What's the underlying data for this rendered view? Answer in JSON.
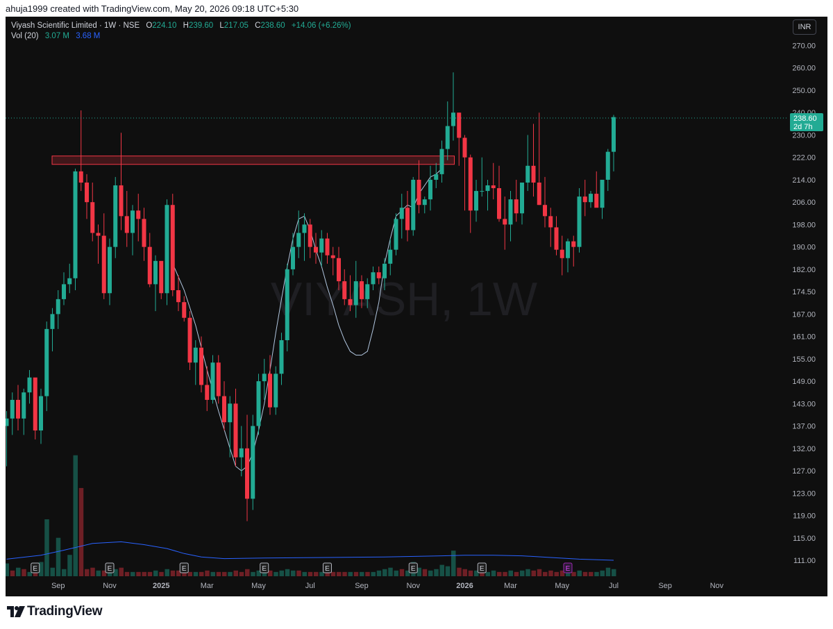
{
  "header": {
    "watermark_text": "ahuja1999 created with TradingView.com, May 20, 2026 09:18 UTC+5:30"
  },
  "legend": {
    "symbol": "Viyash Scientific Limited · 1W · NSE",
    "o_label": "O",
    "o": "224.10",
    "h_label": "H",
    "h": "239.60",
    "l_label": "L",
    "l": "217.05",
    "c_label": "C",
    "c": "238.60",
    "change": "+14.06 (+6.26%)",
    "vol_label": "Vol (20)",
    "vol": "3.07 M",
    "vol_ma": "3.68 M"
  },
  "currency_button": "INR",
  "background_watermark": "VIYASH, 1W",
  "last_price": {
    "value": "238.60",
    "countdown": "2d 7h"
  },
  "earnings_marker": "E",
  "footer": {
    "brand": "TradingView"
  },
  "colors": {
    "up": "#22ab94",
    "down": "#f23645",
    "ma": "#b2c7e0",
    "vol_ma": "#2962ff",
    "zone": "#f23645"
  },
  "chart_data": {
    "type": "candlestick",
    "symbol": "Viyash Scientific Limited",
    "interval": "1W",
    "exchange": "NSE",
    "currency": "INR",
    "y_ticks": [
      270.0,
      260.0,
      250.0,
      240.0,
      230.0,
      222.0,
      214.0,
      206.0,
      198.0,
      190.0,
      182.0,
      174.5,
      167.0,
      161.0,
      155.0,
      149.0,
      143.0,
      137.0,
      132.0,
      127.0,
      123.0,
      119.0,
      115.0,
      111.0
    ],
    "x_ticks": [
      {
        "label": "Sep",
        "bar": 9
      },
      {
        "label": "Nov",
        "bar": 18
      },
      {
        "label": "2025",
        "bar": 27
      },
      {
        "label": "Mar",
        "bar": 35
      },
      {
        "label": "May",
        "bar": 44
      },
      {
        "label": "Jul",
        "bar": 53
      },
      {
        "label": "Sep",
        "bar": 62
      },
      {
        "label": "Nov",
        "bar": 71
      },
      {
        "label": "2026",
        "bar": 80
      },
      {
        "label": "Mar",
        "bar": 88
      },
      {
        "label": "May",
        "bar": 97
      },
      {
        "label": "Jul",
        "bar": 106
      },
      {
        "label": "Sep",
        "bar": 115
      },
      {
        "label": "Nov",
        "bar": 124
      }
    ],
    "resistance_zone": {
      "from_bar": 10,
      "to_bar": 76,
      "low": 219.5,
      "high": 222.5
    },
    "earnings_bars": [
      5,
      18,
      31,
      45,
      56,
      71,
      83,
      98
    ],
    "candles": [
      [
        0,
        137,
        141,
        128,
        139
      ],
      [
        1,
        139,
        146,
        135,
        144
      ],
      [
        2,
        144,
        148,
        136,
        139
      ],
      [
        3,
        139,
        147,
        135,
        146
      ],
      [
        4,
        146,
        152,
        143,
        150
      ],
      [
        5,
        150,
        148,
        134,
        136
      ],
      [
        6,
        136,
        147,
        133,
        145
      ],
      [
        7,
        145,
        165,
        141,
        163
      ],
      [
        8,
        163,
        169,
        157,
        167
      ],
      [
        9,
        167,
        175,
        163,
        172
      ],
      [
        10,
        172,
        181,
        170,
        177
      ],
      [
        11,
        177,
        184,
        174,
        179
      ],
      [
        12,
        179,
        218,
        175,
        217
      ],
      [
        13,
        217,
        241,
        210,
        213
      ],
      [
        14,
        213,
        216,
        200,
        206
      ],
      [
        15,
        206,
        213,
        192,
        195
      ],
      [
        16,
        195,
        198,
        184,
        194
      ],
      [
        17,
        194,
        202,
        172,
        174
      ],
      [
        18,
        174,
        193,
        170,
        190
      ],
      [
        19,
        190,
        215,
        186,
        212
      ],
      [
        20,
        212,
        231,
        196,
        201
      ],
      [
        21,
        201,
        210,
        190,
        195
      ],
      [
        22,
        195,
        205,
        187,
        203
      ],
      [
        23,
        203,
        209,
        192,
        200
      ],
      [
        24,
        200,
        204,
        185,
        190
      ],
      [
        25,
        190,
        195,
        176,
        177
      ],
      [
        26,
        177,
        187,
        168,
        185
      ],
      [
        27,
        185,
        184,
        172,
        174
      ],
      [
        28,
        174,
        207,
        170,
        205
      ],
      [
        29,
        205,
        209,
        173,
        175
      ],
      [
        30,
        175,
        180,
        168,
        171
      ],
      [
        31,
        171,
        173,
        165,
        166
      ],
      [
        32,
        166,
        168,
        152,
        154
      ],
      [
        33,
        154,
        160,
        148,
        158
      ],
      [
        34,
        158,
        161,
        146,
        148
      ],
      [
        35,
        148,
        153,
        141,
        144
      ],
      [
        36,
        144,
        156,
        143,
        154
      ],
      [
        37,
        154,
        156,
        143,
        145
      ],
      [
        38,
        145,
        149,
        136,
        138
      ],
      [
        39,
        138,
        145,
        130,
        143
      ],
      [
        40,
        143,
        147,
        128,
        130
      ],
      [
        41,
        130,
        137,
        126,
        132
      ],
      [
        42,
        132,
        140,
        118,
        122
      ],
      [
        43,
        122,
        140,
        120,
        137
      ],
      [
        44,
        137,
        151,
        135,
        149
      ],
      [
        45,
        149,
        155,
        144,
        151
      ],
      [
        46,
        151,
        156,
        140,
        142
      ],
      [
        47,
        142,
        153,
        140,
        151
      ],
      [
        48,
        151,
        162,
        148,
        160
      ],
      [
        49,
        160,
        184,
        157,
        182
      ],
      [
        50,
        182,
        195,
        180,
        190
      ],
      [
        51,
        190,
        203,
        186,
        195
      ],
      [
        52,
        195,
        202,
        185,
        198
      ],
      [
        53,
        198,
        200,
        186,
        190
      ],
      [
        54,
        190,
        195,
        184,
        188
      ],
      [
        55,
        188,
        196,
        183,
        193
      ],
      [
        56,
        193,
        195,
        184,
        187
      ],
      [
        57,
        187,
        190,
        180,
        186
      ],
      [
        58,
        186,
        190,
        175,
        178
      ],
      [
        59,
        178,
        182,
        170,
        172
      ],
      [
        60,
        172,
        180,
        168,
        170
      ],
      [
        61,
        170,
        185,
        166,
        178
      ],
      [
        62,
        178,
        180,
        169,
        172
      ],
      [
        63,
        172,
        179,
        169,
        177
      ],
      [
        64,
        177,
        183,
        175,
        181
      ],
      [
        65,
        181,
        183,
        177,
        179
      ],
      [
        66,
        179,
        186,
        175,
        184
      ],
      [
        67,
        184,
        193,
        180,
        189
      ],
      [
        68,
        189,
        202,
        187,
        200
      ],
      [
        69,
        200,
        209,
        193,
        204
      ],
      [
        70,
        204,
        210,
        192,
        196
      ],
      [
        71,
        196,
        215,
        194,
        214
      ],
      [
        72,
        214,
        221,
        202,
        205
      ],
      [
        73,
        205,
        208,
        202,
        207
      ],
      [
        74,
        207,
        219,
        203,
        214
      ],
      [
        75,
        214,
        220,
        211,
        216
      ],
      [
        76,
        216,
        228,
        213,
        225
      ],
      [
        77,
        225,
        245,
        221,
        234
      ],
      [
        78,
        234,
        258,
        228,
        240
      ],
      [
        79,
        240,
        240,
        219,
        229
      ],
      [
        80,
        229,
        230,
        203,
        222
      ],
      [
        81,
        222,
        223,
        195,
        203
      ],
      [
        82,
        203,
        214,
        199,
        210
      ],
      [
        83,
        210,
        222,
        208,
        210
      ],
      [
        84,
        210,
        214,
        203,
        212
      ],
      [
        85,
        212,
        220,
        207,
        211
      ],
      [
        86,
        211,
        219,
        199,
        200
      ],
      [
        87,
        200,
        208,
        189,
        198
      ],
      [
        88,
        198,
        210,
        192,
        207
      ],
      [
        89,
        207,
        214,
        199,
        202
      ],
      [
        90,
        202,
        212,
        198,
        213
      ],
      [
        91,
        213,
        230,
        210,
        219
      ],
      [
        92,
        219,
        235,
        208,
        213
      ],
      [
        93,
        213,
        240,
        205,
        205
      ],
      [
        94,
        205,
        215,
        197,
        201
      ],
      [
        95,
        201,
        204,
        190,
        197
      ],
      [
        96,
        197,
        201,
        187,
        189
      ],
      [
        97,
        189,
        194,
        180,
        186
      ],
      [
        98,
        186,
        193,
        181,
        192
      ],
      [
        99,
        192,
        194,
        183,
        190
      ],
      [
        100,
        190,
        211,
        188,
        208
      ],
      [
        101,
        208,
        214,
        201,
        206
      ],
      [
        102,
        206,
        210,
        204,
        209
      ],
      [
        103,
        209,
        217,
        205,
        204
      ],
      [
        104,
        204,
        213,
        200,
        214
      ],
      [
        105,
        214,
        225,
        210,
        224
      ],
      [
        106,
        224,
        239,
        217,
        238
      ]
    ],
    "volume_ma": [
      [
        0,
        111.2
      ],
      [
        6,
        111.9
      ],
      [
        10,
        112.8
      ],
      [
        15,
        114.0
      ],
      [
        20,
        114.3
      ],
      [
        24,
        113.8
      ],
      [
        28,
        113.1
      ],
      [
        31,
        112.2
      ],
      [
        34,
        111.6
      ],
      [
        38,
        111.3
      ],
      [
        45,
        111.4
      ],
      [
        56,
        111.5
      ],
      [
        66,
        111.6
      ],
      [
        76,
        111.8
      ],
      [
        80,
        111.9
      ],
      [
        85,
        111.9
      ],
      [
        90,
        111.8
      ],
      [
        95,
        111.5
      ],
      [
        100,
        111.2
      ],
      [
        106,
        111.0
      ]
    ],
    "ma_line": [
      [
        29,
        184
      ],
      [
        31,
        175
      ],
      [
        33,
        164
      ],
      [
        35,
        152
      ],
      [
        37,
        141
      ],
      [
        39,
        132
      ],
      [
        40,
        128
      ],
      [
        41,
        127
      ],
      [
        42,
        128
      ],
      [
        43,
        131
      ],
      [
        44,
        136
      ],
      [
        45,
        143
      ],
      [
        46,
        152
      ],
      [
        47,
        162
      ],
      [
        48,
        172
      ],
      [
        49,
        183
      ],
      [
        50,
        193
      ],
      [
        51,
        200
      ],
      [
        52,
        201
      ],
      [
        53,
        196
      ],
      [
        54,
        189
      ],
      [
        55,
        183
      ],
      [
        56,
        176
      ],
      [
        57,
        170
      ],
      [
        58,
        164
      ],
      [
        59,
        160
      ],
      [
        60,
        157
      ],
      [
        61,
        156
      ],
      [
        62,
        156
      ],
      [
        63,
        157
      ],
      [
        64,
        163
      ],
      [
        65,
        171
      ],
      [
        66,
        184
      ],
      [
        67,
        193
      ],
      [
        68,
        201
      ],
      [
        69,
        203
      ],
      [
        70,
        205
      ],
      [
        71,
        204
      ],
      [
        72,
        209
      ],
      [
        73,
        212
      ],
      [
        74,
        215
      ],
      [
        75,
        216
      ],
      [
        76,
        218
      ]
    ],
    "volumes": [
      [
        0,
        0.9,
        1
      ],
      [
        1,
        0.4,
        0
      ],
      [
        2,
        0.6,
        1
      ],
      [
        3,
        0.5,
        0
      ],
      [
        4,
        0.3,
        1
      ],
      [
        5,
        0.7,
        0
      ],
      [
        6,
        1.0,
        1
      ],
      [
        7,
        4.0,
        1
      ],
      [
        8,
        0.6,
        1
      ],
      [
        9,
        2.7,
        1
      ],
      [
        10,
        0.5,
        1
      ],
      [
        11,
        1.5,
        1
      ],
      [
        12,
        8.5,
        1
      ],
      [
        13,
        6.2,
        0
      ],
      [
        14,
        0.5,
        0
      ],
      [
        15,
        0.6,
        0
      ],
      [
        16,
        0.4,
        1
      ],
      [
        17,
        0.4,
        0
      ],
      [
        18,
        0.5,
        1
      ],
      [
        19,
        0.5,
        1
      ],
      [
        20,
        0.6,
        0
      ],
      [
        21,
        0.3,
        0
      ],
      [
        22,
        0.3,
        1
      ],
      [
        23,
        0.3,
        0
      ],
      [
        24,
        0.3,
        0
      ],
      [
        25,
        0.3,
        0
      ],
      [
        26,
        0.4,
        1
      ],
      [
        27,
        0.3,
        0
      ],
      [
        28,
        0.5,
        1
      ],
      [
        29,
        0.4,
        0
      ],
      [
        30,
        0.4,
        0
      ],
      [
        31,
        0.3,
        0
      ],
      [
        32,
        0.3,
        0
      ],
      [
        33,
        0.3,
        1
      ],
      [
        34,
        0.3,
        0
      ],
      [
        35,
        0.4,
        0
      ],
      [
        36,
        0.3,
        1
      ],
      [
        37,
        0.3,
        0
      ],
      [
        38,
        0.3,
        0
      ],
      [
        39,
        0.3,
        1
      ],
      [
        40,
        0.4,
        0
      ],
      [
        41,
        0.3,
        0
      ],
      [
        42,
        0.5,
        0
      ],
      [
        43,
        0.3,
        1
      ],
      [
        44,
        0.4,
        1
      ],
      [
        45,
        0.5,
        1
      ],
      [
        46,
        0.4,
        0
      ],
      [
        47,
        0.3,
        1
      ],
      [
        48,
        0.4,
        1
      ],
      [
        49,
        0.5,
        1
      ],
      [
        50,
        0.4,
        1
      ],
      [
        51,
        0.4,
        0
      ],
      [
        52,
        0.3,
        1
      ],
      [
        53,
        0.3,
        0
      ],
      [
        54,
        0.3,
        0
      ],
      [
        55,
        0.3,
        1
      ],
      [
        56,
        0.3,
        0
      ],
      [
        57,
        0.3,
        0
      ],
      [
        58,
        0.3,
        0
      ],
      [
        59,
        0.3,
        0
      ],
      [
        60,
        0.3,
        1
      ],
      [
        61,
        0.3,
        0
      ],
      [
        62,
        0.3,
        1
      ],
      [
        63,
        0.3,
        0
      ],
      [
        64,
        0.3,
        1
      ],
      [
        65,
        0.4,
        1
      ],
      [
        66,
        0.5,
        1
      ],
      [
        67,
        0.6,
        1
      ],
      [
        68,
        0.4,
        1
      ],
      [
        69,
        0.5,
        0
      ],
      [
        70,
        0.4,
        1
      ],
      [
        71,
        1.0,
        1
      ],
      [
        72,
        0.6,
        1
      ],
      [
        73,
        0.5,
        0
      ],
      [
        74,
        0.4,
        1
      ],
      [
        75,
        0.5,
        1
      ],
      [
        76,
        0.8,
        1
      ],
      [
        77,
        0.7,
        1
      ],
      [
        78,
        1.8,
        1
      ],
      [
        79,
        0.6,
        0
      ],
      [
        80,
        0.5,
        0
      ],
      [
        81,
        0.4,
        0
      ],
      [
        82,
        0.4,
        1
      ],
      [
        83,
        0.3,
        0
      ],
      [
        84,
        0.3,
        1
      ],
      [
        85,
        0.4,
        1
      ],
      [
        86,
        0.3,
        0
      ],
      [
        87,
        0.3,
        0
      ],
      [
        88,
        0.4,
        1
      ],
      [
        89,
        0.3,
        0
      ],
      [
        90,
        0.4,
        1
      ],
      [
        91,
        0.5,
        1
      ],
      [
        92,
        0.4,
        0
      ],
      [
        93,
        0.5,
        0
      ],
      [
        94,
        0.3,
        0
      ],
      [
        95,
        0.4,
        0
      ],
      [
        96,
        0.3,
        0
      ],
      [
        97,
        0.4,
        0
      ],
      [
        98,
        0.4,
        1
      ],
      [
        99,
        0.3,
        0
      ],
      [
        100,
        0.4,
        1
      ],
      [
        101,
        0.3,
        0
      ],
      [
        102,
        0.3,
        0
      ],
      [
        103,
        0.3,
        1
      ],
      [
        104,
        0.4,
        1
      ],
      [
        105,
        0.6,
        1
      ],
      [
        106,
        0.5,
        1
      ]
    ]
  }
}
